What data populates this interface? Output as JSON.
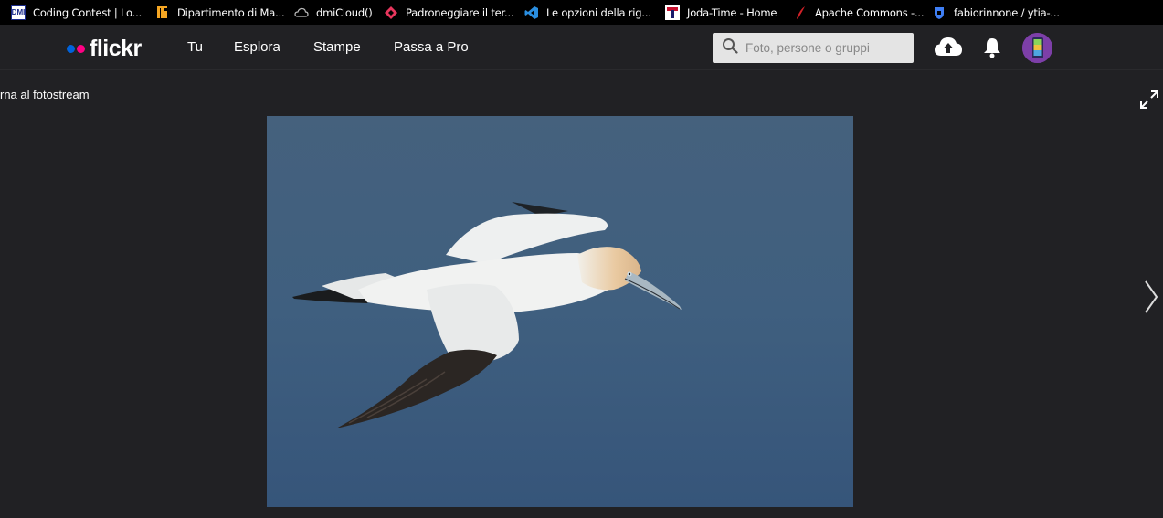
{
  "bookmarks": [
    {
      "label": "Coding Contest | Lo...",
      "icon": "dmi-icon"
    },
    {
      "label": "Dipartimento di Ma...",
      "icon": "unict-icon"
    },
    {
      "label": "dmiCloud()",
      "icon": "cloud-icon"
    },
    {
      "label": "Padroneggiare il ter...",
      "icon": "diamond-icon"
    },
    {
      "label": "Le opzioni della rig...",
      "icon": "vscode-icon"
    },
    {
      "label": "Joda-Time - Home",
      "icon": "joda-icon"
    },
    {
      "label": "Apache Commons -...",
      "icon": "feather-icon"
    },
    {
      "label": "fabiorinnone / ytia-...",
      "icon": "shield-icon"
    }
  ],
  "nav": {
    "logo": "flickr",
    "links": [
      "Tu",
      "Esplora",
      "Stampe",
      "Passa a Pro"
    ],
    "search_placeholder": "Foto, persone o gruppi"
  },
  "photo_page": {
    "back_link": "rna al fotostream"
  },
  "colors": {
    "flickr_blue": "#0063dc",
    "flickr_pink": "#ff0084",
    "background": "#212124",
    "photo_sea": "#3f5f7e"
  }
}
